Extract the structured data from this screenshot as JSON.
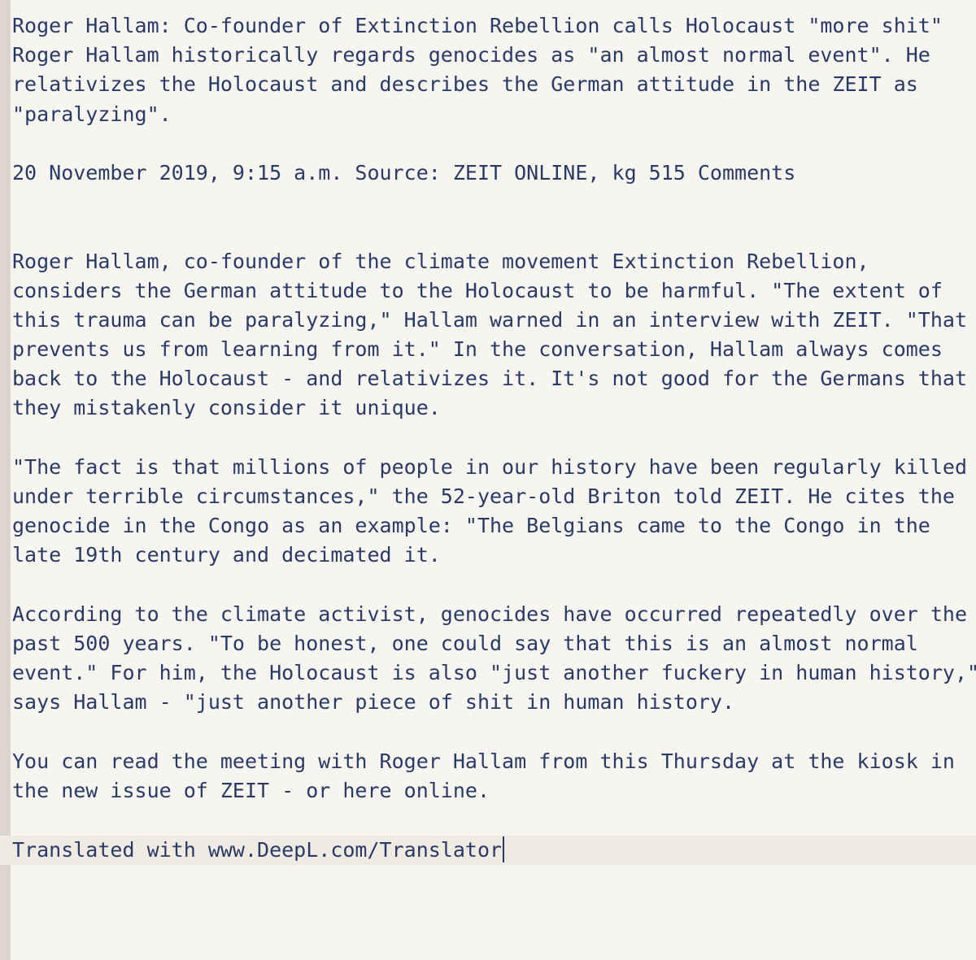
{
  "editor": {
    "lines": [
      "Roger Hallam: Co-founder of Extinction Rebellion calls Holocaust \"more shit\"",
      "Roger Hallam historically regards genocides as \"an almost normal event\". He",
      "relativizes the Holocaust and describes the German attitude in the ZEIT as",
      "\"paralyzing\".",
      "",
      "20 November 2019, 9:15 a.m. Source: ZEIT ONLINE, kg 515 Comments",
      "",
      "",
      "Roger Hallam, co-founder of the climate movement Extinction Rebellion,",
      "considers the German attitude to the Holocaust to be harmful. \"The extent of",
      "this trauma can be paralyzing,\" Hallam warned in an interview with ZEIT. \"That",
      "prevents us from learning from it.\" In the conversation, Hallam always comes",
      "back to the Holocaust - and relativizes it. It's not good for the Germans that",
      "they mistakenly consider it unique.",
      "",
      "\"The fact is that millions of people in our history have been regularly killed",
      "under terrible circumstances,\" the 52-year-old Briton told ZEIT. He cites the",
      "genocide in the Congo as an example: \"The Belgians came to the Congo in the",
      "late 19th century and decimated it.",
      "",
      "According to the climate activist, genocides have occurred repeatedly over the",
      "past 500 years. \"To be honest, one could say that this is an almost normal",
      "event.\" For him, the Holocaust is also \"just another fuckery in human history,\"",
      "says Hallam - \"just another piece of shit in human history.",
      "",
      "You can read the meeting with Roger Hallam from this Thursday at the kiosk in",
      "the new issue of ZEIT - or here online.",
      ""
    ],
    "current_line": "Translated with www.DeepL.com/Translator"
  },
  "colors": {
    "background": "#f7f5f0",
    "text": "#2a3a66",
    "gutter": "#ddd6cc",
    "current_line_highlight": "#f0ebe2"
  }
}
